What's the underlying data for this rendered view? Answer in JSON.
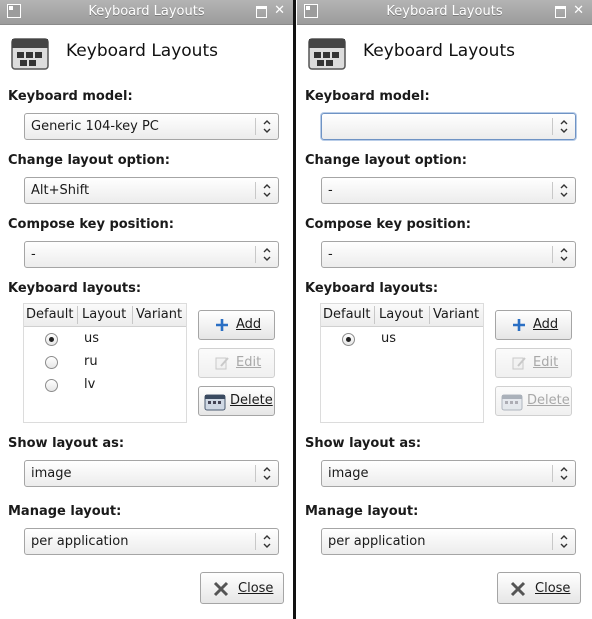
{
  "windows": [
    {
      "title": "Keyboard Layouts",
      "heading": "Keyboard Layouts",
      "keyboard_model_label": "Keyboard model:",
      "keyboard_model_value": "Generic 104-key PC",
      "change_layout_label": "Change layout option:",
      "change_layout_value": "Alt+Shift",
      "compose_key_label": "Compose key position:",
      "compose_key_value": "-",
      "layouts_label": "Keyboard layouts:",
      "columns": [
        "Default",
        "Layout",
        "Variant"
      ],
      "rows": [
        {
          "default": true,
          "layout": "us"
        },
        {
          "default": false,
          "layout": "ru"
        },
        {
          "default": false,
          "layout": "lv"
        }
      ],
      "add_label": "Add",
      "edit_label": "Edit",
      "delete_label": "Delete",
      "show_layout_label": "Show layout as:",
      "show_layout_value": "image",
      "manage_layout_label": "Manage layout:",
      "manage_layout_value": "per application",
      "close_label": "Close"
    },
    {
      "title": "Keyboard Layouts",
      "heading": "Keyboard Layouts",
      "keyboard_model_label": "Keyboard model:",
      "keyboard_model_value": "",
      "change_layout_label": "Change layout option:",
      "change_layout_value": "-",
      "compose_key_label": "Compose key position:",
      "compose_key_value": "-",
      "layouts_label": "Keyboard layouts:",
      "columns": [
        "Default",
        "Layout",
        "Variant"
      ],
      "rows": [
        {
          "default": true,
          "layout": "us"
        }
      ],
      "add_label": "Add",
      "edit_label": "Edit",
      "delete_label": "Delete",
      "show_layout_label": "Show layout as:",
      "show_layout_value": "image",
      "manage_layout_label": "Manage layout:",
      "manage_layout_value": "per application",
      "close_label": "Close"
    }
  ],
  "icons": {
    "app": "keyboard-icon",
    "add": "plus-icon",
    "edit": "pencil-icon",
    "delete": "keyboard-delete-icon",
    "close": "x-icon"
  },
  "colors": {
    "titlebar": "#a8a8a8",
    "add_icon": "#2a6fc4",
    "close_icon": "#555555"
  }
}
